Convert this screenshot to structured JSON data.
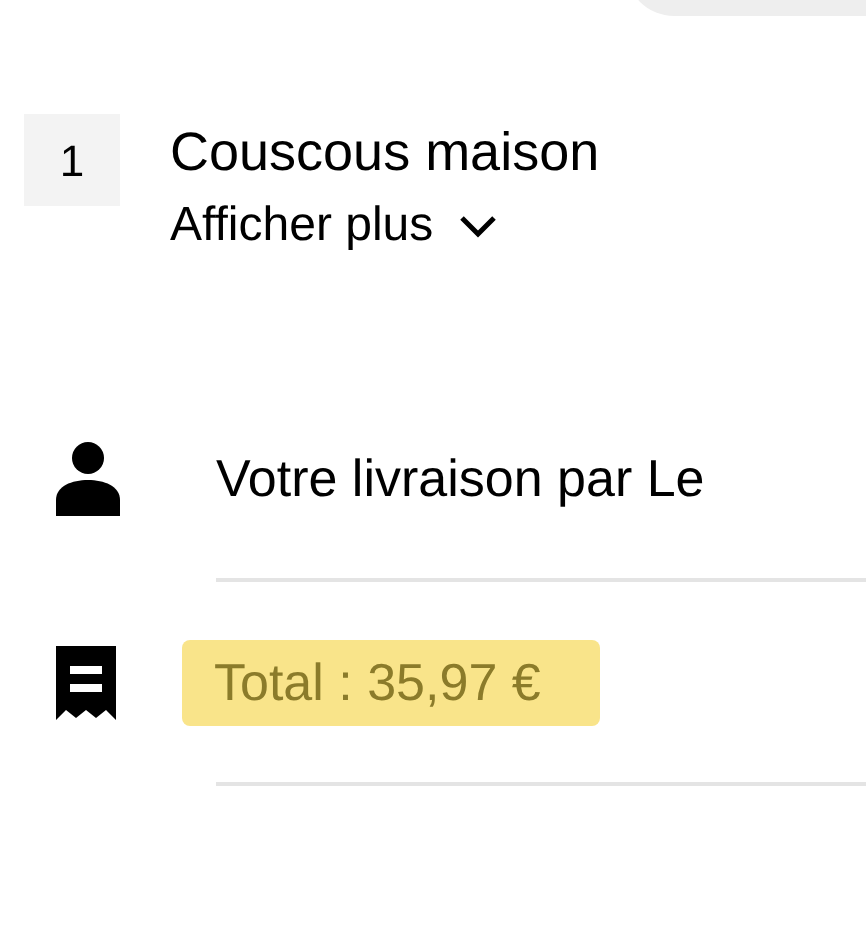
{
  "item": {
    "quantity": "1",
    "name": "Couscous maison",
    "more_label": "Afficher plus"
  },
  "rows": [
    {
      "kind": "courier",
      "text": "Votre livraison par Le",
      "highlighted": false
    },
    {
      "kind": "receipt",
      "text": "Total : 35,97 €",
      "highlighted": true
    }
  ]
}
